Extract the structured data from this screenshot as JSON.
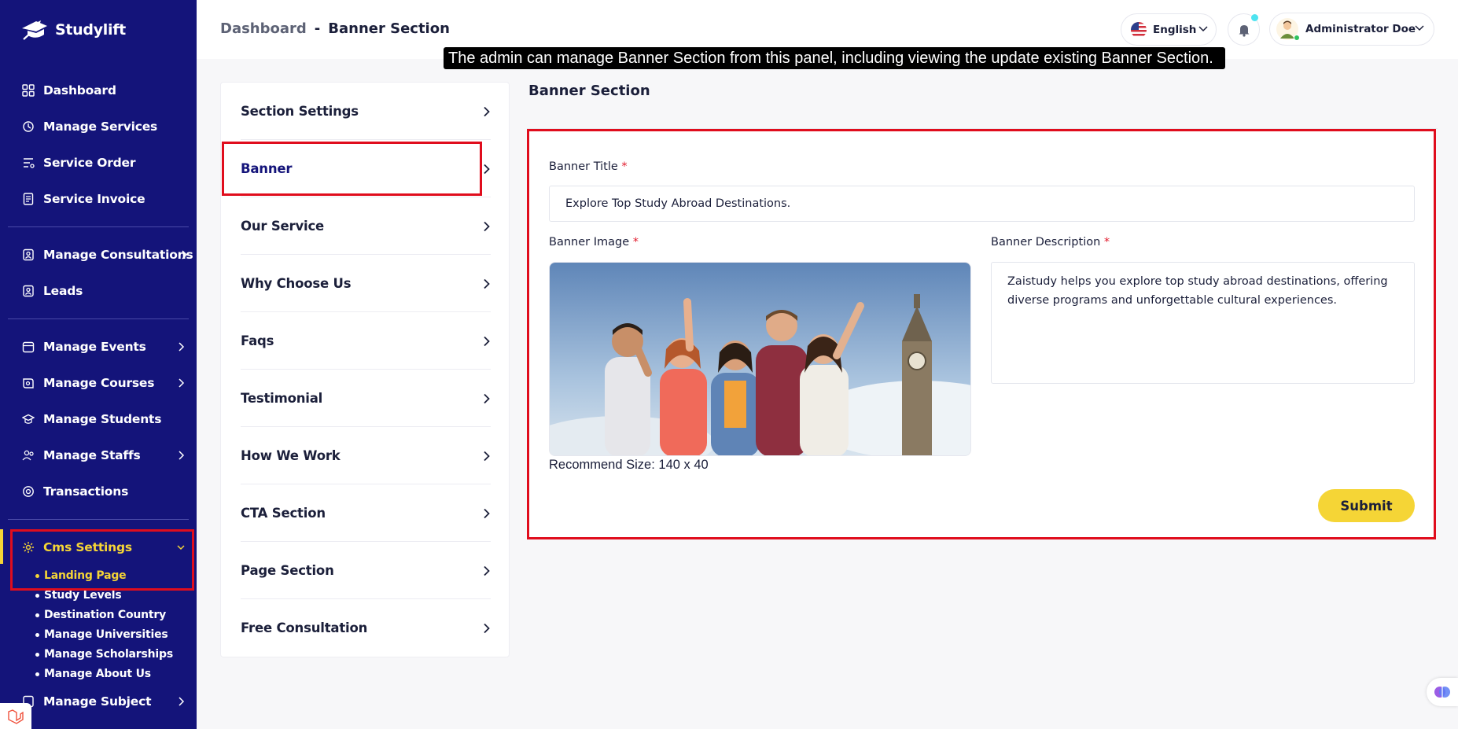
{
  "brand": {
    "name": "Studylift"
  },
  "sidebar": {
    "items": [
      {
        "label": "Dashboard",
        "icon": "dashboard-icon"
      },
      {
        "label": "Manage Services",
        "icon": "services-icon"
      },
      {
        "label": "Service Order",
        "icon": "order-icon"
      },
      {
        "label": "Service Invoice",
        "icon": "invoice-icon"
      },
      {
        "label": "Manage Consultations",
        "icon": "consultation-icon"
      },
      {
        "label": "Leads",
        "icon": "leads-icon"
      },
      {
        "label": "Manage Events",
        "icon": "events-icon"
      },
      {
        "label": "Manage Courses",
        "icon": "courses-icon"
      },
      {
        "label": "Manage Students",
        "icon": "students-icon"
      },
      {
        "label": "Manage Staffs",
        "icon": "staffs-icon"
      },
      {
        "label": "Transactions",
        "icon": "transactions-icon"
      },
      {
        "label": "Cms Settings",
        "icon": "cms-icon"
      },
      {
        "label": "Manage Subject",
        "icon": "subject-icon"
      }
    ],
    "cms_sub": [
      "Landing Page",
      "Study Levels",
      "Destination Country",
      "Manage Universities",
      "Manage Scholarships",
      "Manage About Us"
    ]
  },
  "header": {
    "crumb_home": "Dashboard",
    "crumb_sep": "-",
    "crumb_current": "Banner Section",
    "language": "English",
    "user_name": "Administrator Doe"
  },
  "tooltip": "The admin can manage Banner Section from this panel, including viewing the update existing Banner Section.",
  "settings_menu": [
    "Section Settings",
    "Banner",
    "Our Service",
    "Why Choose Us",
    "Faqs",
    "Testimonial",
    "How We Work",
    "CTA Section",
    "Page Section",
    "Free Consultation"
  ],
  "form": {
    "section_title": "Banner Section",
    "title_label": "Banner Title",
    "title_value": "Explore Top  Study Abroad  Destinations.",
    "image_label": "Banner Image",
    "recommend": "Recommend Size: 140 x 40",
    "desc_label": "Banner Description",
    "desc_value": "Zaistudy helps you explore top study abroad destinations, offering diverse programs and unforgettable cultural experiences.",
    "required_mark": "*",
    "submit_label": "Submit"
  },
  "colors": {
    "sidebar": "#14147a",
    "accent": "#f5d536",
    "highlight": "#e00d1d"
  }
}
